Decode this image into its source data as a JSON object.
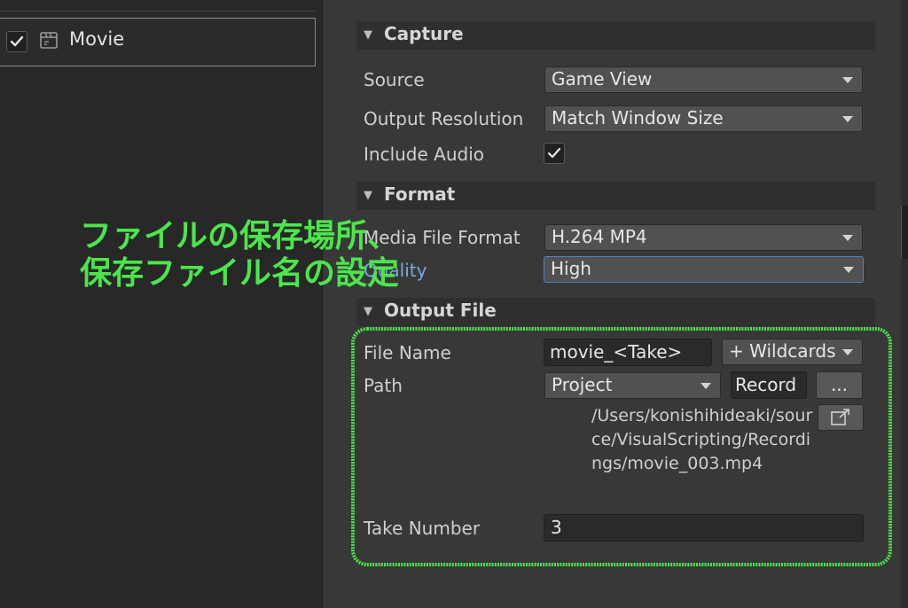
{
  "recorder_list": {
    "items": [
      {
        "label": "Movie",
        "enabled": true,
        "icon": "movie-clapper-icon"
      }
    ]
  },
  "capture": {
    "title": "Capture",
    "source_label": "Source",
    "source_value": "Game View",
    "output_resolution_label": "Output Resolution",
    "output_resolution_value": "Match Window Size",
    "include_audio_label": "Include Audio",
    "include_audio_checked": true
  },
  "format": {
    "title": "Format",
    "media_file_format_label": "Media File Format",
    "media_file_format_value": "H.264 MP4",
    "quality_label": "Quality",
    "quality_value": "High"
  },
  "output_file": {
    "title": "Output File",
    "file_name_label": "File Name",
    "file_name_value": "movie_<Take>",
    "wildcards_label": "+ Wildcards",
    "path_label": "Path",
    "path_root_value": "Project",
    "path_folder_value": "Record",
    "browse_label": "...",
    "resolved_path": "/Users/konishihideaki/source/VisualScripting/Recordings/movie_003.mp4",
    "take_number_label": "Take Number",
    "take_number_value": "3"
  },
  "annotation": {
    "line1": "ファイルの保存場所、",
    "line2": "保存ファイル名の設定",
    "color": "#4be64b"
  },
  "colors": {
    "panel_bg": "#383838",
    "list_bg": "#282828",
    "focus_border": "#4d82c8",
    "annotation_green": "#4be64b"
  }
}
